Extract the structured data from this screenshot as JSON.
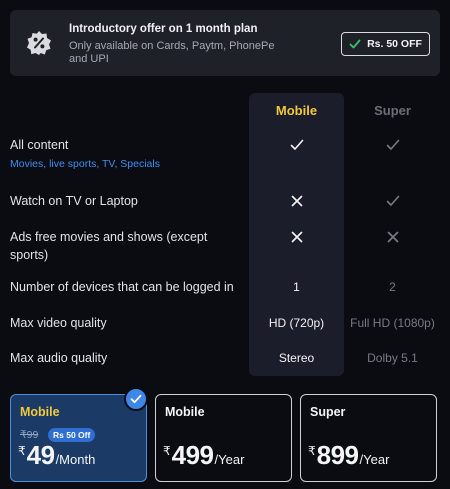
{
  "offer": {
    "title": "Introductory offer on 1 month plan",
    "subtitle": "Only available on Cards, Paytm, PhonePe and UPI",
    "badge_icon": "discount-icon",
    "pill_label": "Rs. 50 OFF",
    "pill_icon": "check-icon"
  },
  "columns": {
    "mobile": "Mobile",
    "super": "Super"
  },
  "features": [
    {
      "label": "All content",
      "sublabel": "Movies, live sports, TV, Specials",
      "mobile": "check",
      "super": "check"
    },
    {
      "label": "Watch on TV or Laptop",
      "mobile": "cross",
      "super": "check"
    },
    {
      "label": "Ads free movies and shows (except sports)",
      "mobile": "cross",
      "super": "cross"
    },
    {
      "label": "Number of devices that can be logged in",
      "mobile": "1",
      "super": "2"
    },
    {
      "label": "Max video quality",
      "mobile": "HD (720p)",
      "super": "Full HD (1080p)"
    },
    {
      "label": "Max audio quality",
      "mobile": "Stereo",
      "super": "Dolby 5.1"
    }
  ],
  "plans": [
    {
      "name": "Mobile",
      "old_price": "₹99",
      "discount": "Rs 50 Off",
      "currency": "₹",
      "price": "49",
      "period": "/Month",
      "selected": true
    },
    {
      "name": "Mobile",
      "currency": "₹",
      "price": "499",
      "period": "/Year",
      "selected": false
    },
    {
      "name": "Super",
      "currency": "₹",
      "price": "899",
      "period": "/Year",
      "selected": false
    }
  ],
  "colors": {
    "accent_gold": "#f0c93c",
    "selected_blue": "#1b3a66",
    "link_blue": "#3d8ef0",
    "background": "#0b0c11"
  }
}
